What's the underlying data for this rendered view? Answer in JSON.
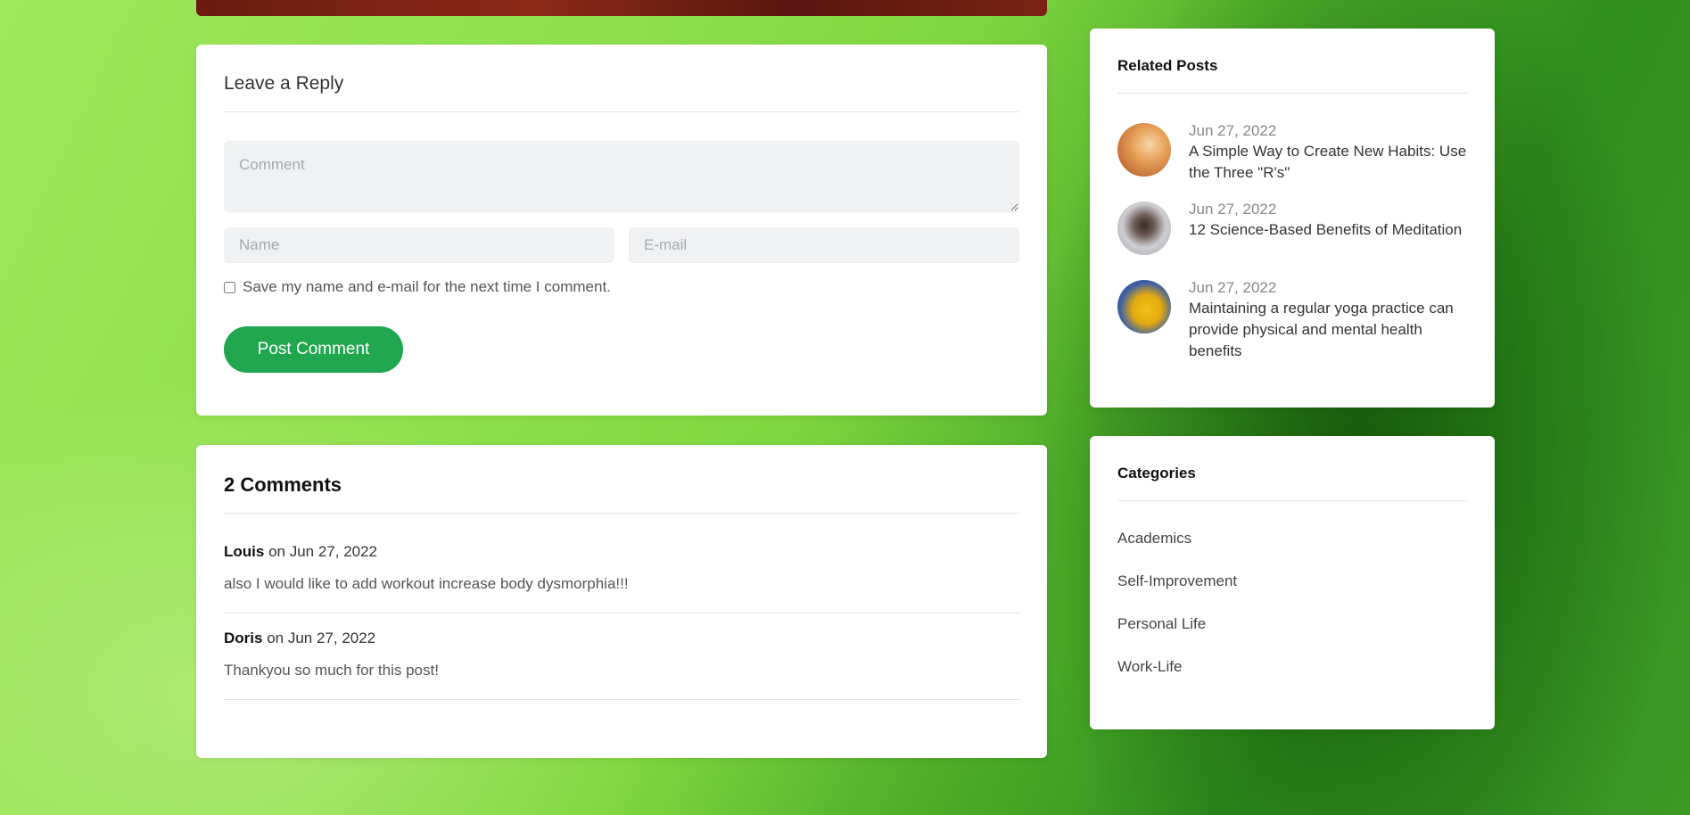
{
  "reply": {
    "title": "Leave a Reply",
    "comment_placeholder": "Comment",
    "name_placeholder": "Name",
    "email_placeholder": "E-mail",
    "save_label": "Save my name and e-mail for the next time I comment.",
    "submit_label": "Post Comment"
  },
  "comments": {
    "title": "2 Comments",
    "items": [
      {
        "author": "Louis",
        "date": "on Jun 27, 2022",
        "text": "also I would like to add workout increase body dysmorphia!!!"
      },
      {
        "author": "Doris",
        "date": "on Jun 27, 2022",
        "text": "Thankyou so much for this post!"
      }
    ]
  },
  "related": {
    "title": "Related Posts",
    "items": [
      {
        "date": "Jun 27, 2022",
        "title": "A Simple Way to Create New Habits: Use the Three \"R's\""
      },
      {
        "date": "Jun 27, 2022",
        "title": "12 Science-Based Benefits of Meditation"
      },
      {
        "date": "Jun 27, 2022",
        "title": "Maintaining a regular yoga practice can provide physical and mental health benefits"
      }
    ]
  },
  "categories": {
    "title": "Categories",
    "items": [
      "Academics",
      "Self-Improvement",
      "Personal Life",
      "Work-Life"
    ]
  },
  "colors": {
    "accent": "#1fa64e",
    "background": "#7fd63f"
  }
}
